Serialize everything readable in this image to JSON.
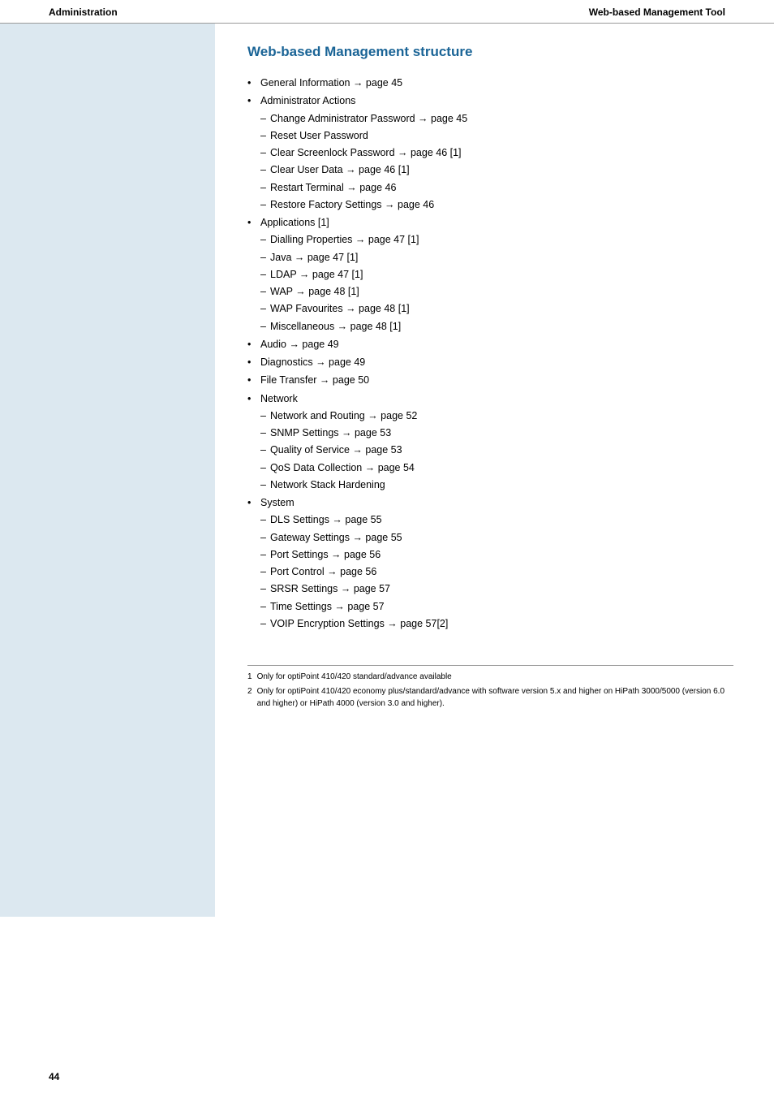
{
  "header": {
    "left": "Administration",
    "right": "Web-based Management Tool"
  },
  "page_title": "Web-based Management structure",
  "page_number": "44",
  "structure": [
    {
      "label": "General Information → page 45",
      "sub": []
    },
    {
      "label": "Administrator Actions",
      "sub": [
        "Change Administrator Password → page 45",
        "Reset User Password",
        "Clear Screenlock Password → page 46 [1]",
        "Clear User Data → page 46 [1]",
        "Restart Terminal → page 46",
        "Restore Factory Settings → page 46"
      ]
    },
    {
      "label": "Applications [1]",
      "sub": [
        "Dialling Properties → page 47 [1]",
        "Java → page 47 [1]",
        "LDAP → page 47 [1]",
        "WAP → page 48 [1]",
        "WAP Favourites → page 48 [1]",
        "Miscellaneous → page 48 [1]"
      ]
    },
    {
      "label": "Audio → page 49",
      "sub": []
    },
    {
      "label": "Diagnostics → page 49",
      "sub": []
    },
    {
      "label": "File Transfer → page 50",
      "sub": []
    },
    {
      "label": "Network",
      "sub": [
        "Network and Routing → page 52",
        "SNMP Settings → page 53",
        "Quality of Service → page 53",
        "QoS Data Collection → page 54",
        "Network Stack Hardening"
      ]
    },
    {
      "label": "System",
      "sub": [
        "DLS Settings → page 55",
        "Gateway Settings → page 55",
        "Port Settings → page 56",
        "Port Control → page 56",
        "SRSR Settings → page 57",
        "Time Settings → page 57",
        "VOIP Encryption Settings → page 57[2]"
      ]
    }
  ],
  "footnotes": [
    {
      "num": "1",
      "text": "Only for optiPoint 410/420 standard/advance available"
    },
    {
      "num": "2",
      "text": "Only for optiPoint 410/420 economy plus/standard/advance with software version 5.x and higher on HiPath 3000/5000 (version 6.0 and higher) or HiPath 4000 (version 3.0 and higher)."
    }
  ]
}
